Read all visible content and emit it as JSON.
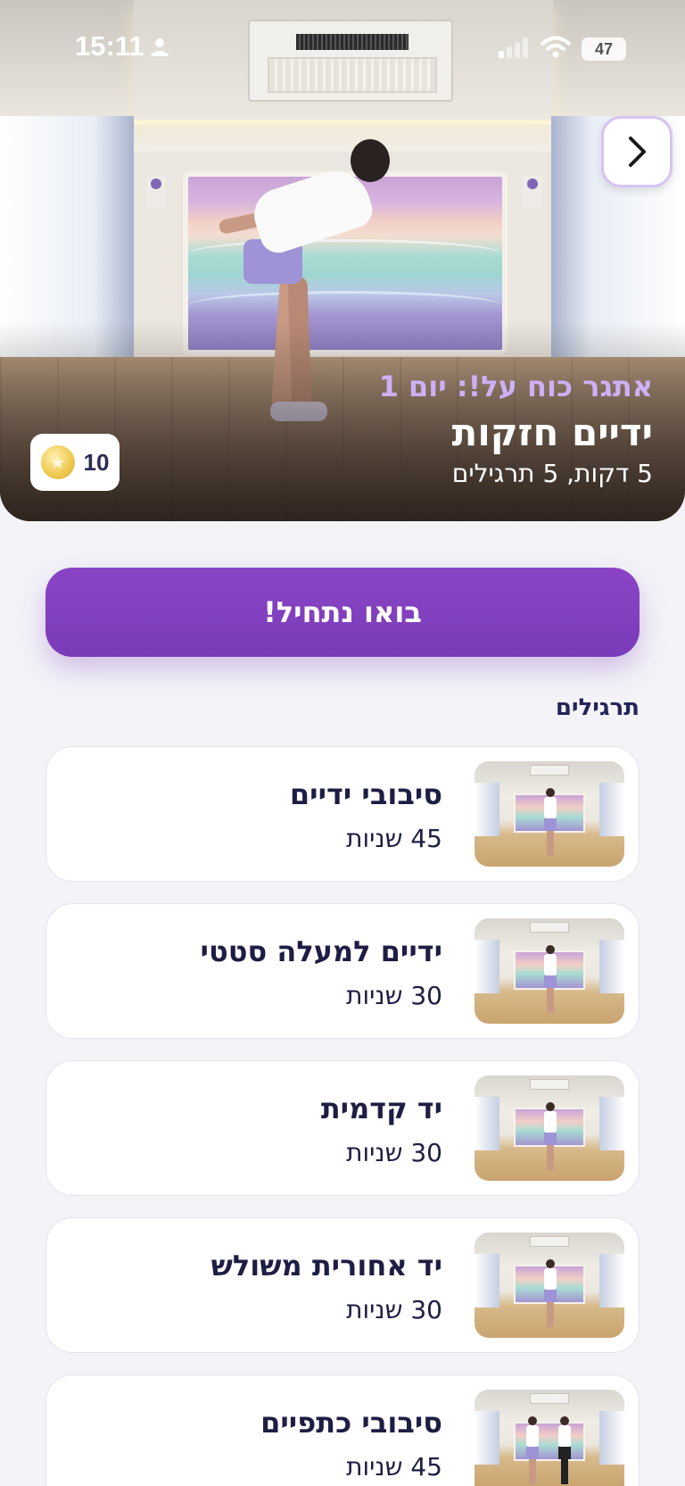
{
  "status_bar": {
    "time": "15:11",
    "battery": "47",
    "icons": [
      "person-icon",
      "signal-icon",
      "wifi-icon",
      "battery-icon"
    ]
  },
  "hero": {
    "challenge_title": "אתגר כוח על!: יום 1",
    "workout_title": "ידיים חזקות",
    "workout_meta": "5 דקות, 5 תרגילים",
    "coins": "10",
    "next_icon": "chevron-right-icon"
  },
  "start_button": {
    "label": "בואו נתחיל!"
  },
  "exercises_section": {
    "title": "תרגילים",
    "items": [
      {
        "name": "סיבובי ידיים",
        "duration": "45 שניות"
      },
      {
        "name": "ידיים למעלה סטטי",
        "duration": "30 שניות"
      },
      {
        "name": "יד קדמית",
        "duration": "30 שניות"
      },
      {
        "name": "יד אחורית משולש",
        "duration": "30 שניות"
      },
      {
        "name": "סיבובי כתפיים",
        "duration": "45 שניות"
      }
    ]
  },
  "colors": {
    "accent_purple": "#7d3fbb",
    "challenge_text": "#cdb0f6",
    "background": "#f3f3f8",
    "dark_text": "#1e1e44"
  }
}
